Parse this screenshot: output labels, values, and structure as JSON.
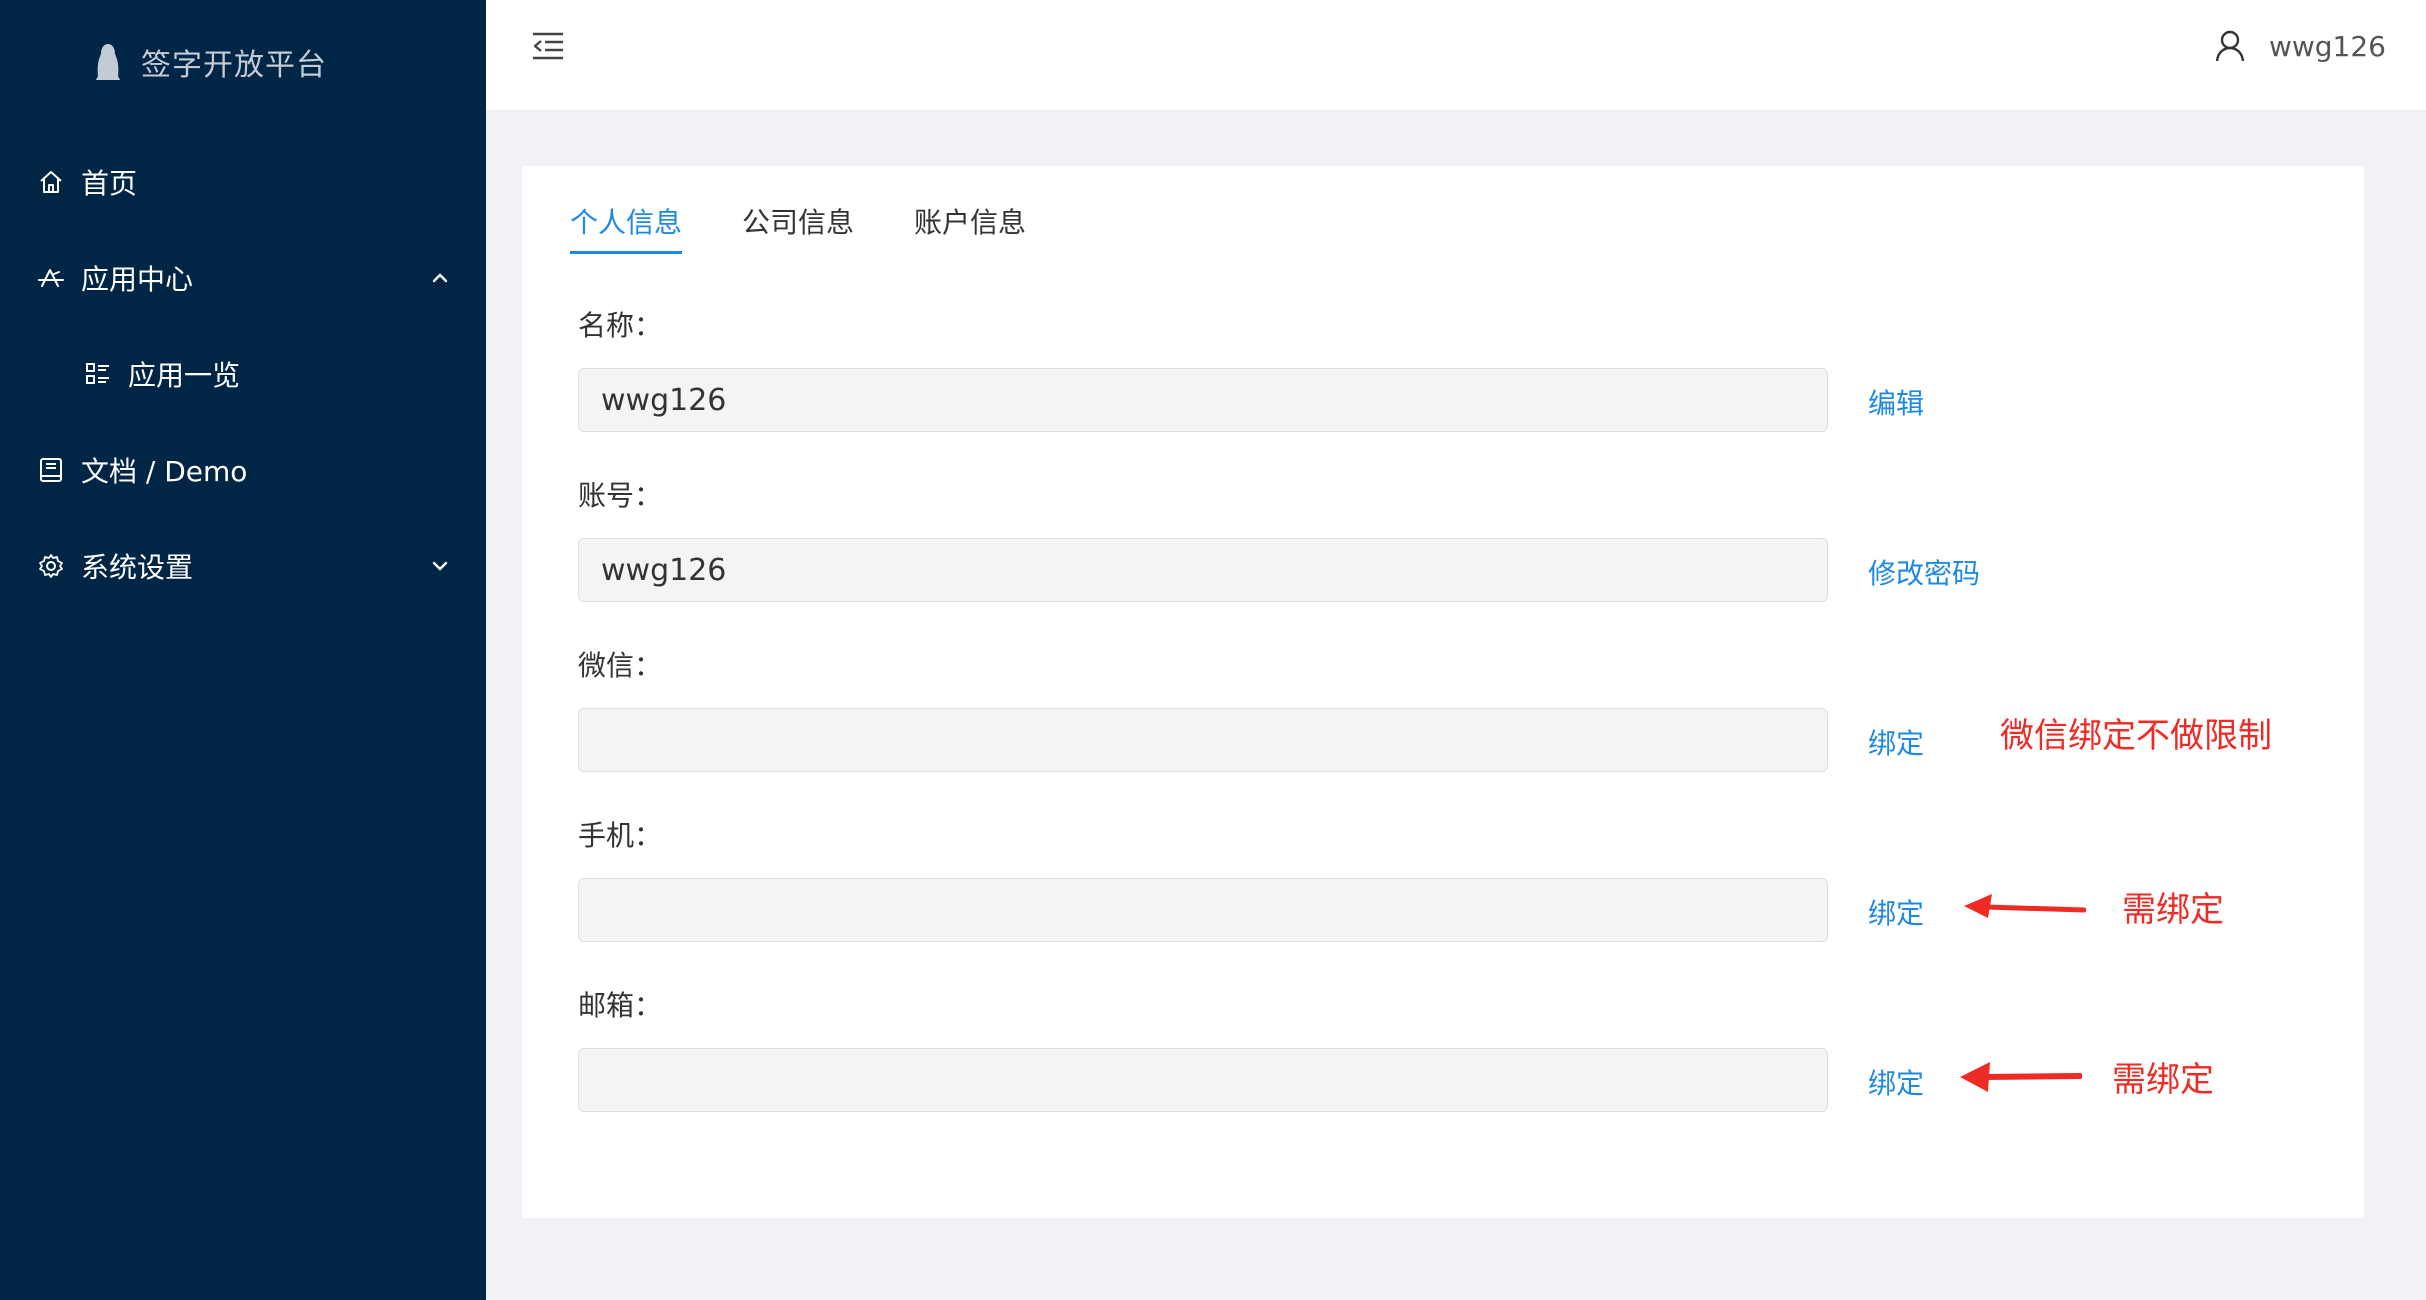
{
  "sidebar": {
    "logo_text": "签字开放平台",
    "items": [
      {
        "label": "首页",
        "icon": "home-icon"
      },
      {
        "label": "应用中心",
        "icon": "app-store-icon"
      },
      {
        "label": "应用一览",
        "icon": "list-icon"
      },
      {
        "label": "文档 / Demo",
        "icon": "book-icon"
      },
      {
        "label": "系统设置",
        "icon": "gear-icon"
      }
    ]
  },
  "header": {
    "username": "wwg126"
  },
  "tabs": [
    "个人信息",
    "公司信息",
    "账户信息"
  ],
  "fields": [
    {
      "label": "名称：",
      "value": "wwg126",
      "action": "编辑"
    },
    {
      "label": "账号：",
      "value": "wwg126",
      "action": "修改密码"
    },
    {
      "label": "微信：",
      "value": "",
      "action": "绑定"
    },
    {
      "label": "手机：",
      "value": "",
      "action": "绑定"
    },
    {
      "label": "邮箱：",
      "value": "",
      "action": "绑定"
    }
  ],
  "annotations": {
    "wechat_note": "微信绑定不做限制",
    "phone_note": "需绑定",
    "email_note": "需绑定",
    "color": "#ee2b24"
  },
  "colors": {
    "sidebar_bg": "#002545",
    "accent": "#1e88e5"
  }
}
